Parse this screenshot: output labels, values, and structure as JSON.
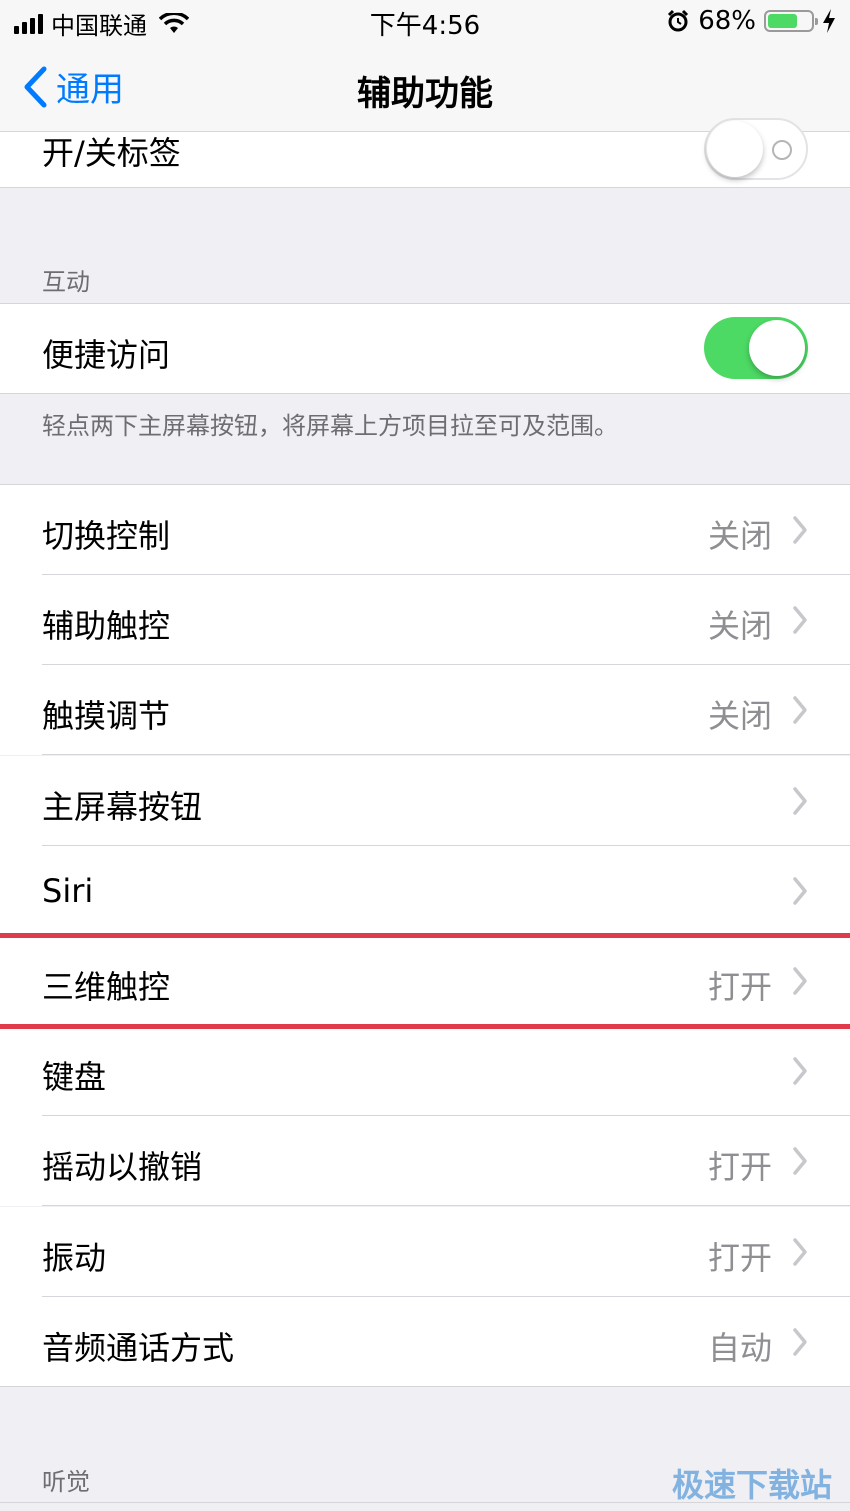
{
  "status_bar": {
    "carrier": "中国联通",
    "time": "下午4:56",
    "battery_percent": "68%",
    "battery_level": 0.68
  },
  "nav": {
    "back_label": "通用",
    "title": "辅助功能"
  },
  "top_cell": {
    "label": "开/关标签",
    "toggle": false
  },
  "section_interaction": {
    "header": "互动"
  },
  "reachability": {
    "label": "便捷访问",
    "toggle": true,
    "footer": "轻点两下主屏幕按钮，将屏幕上方项目拉至可及范围。"
  },
  "rows": [
    {
      "label": "切换控制",
      "value": "关闭"
    },
    {
      "label": "辅助触控",
      "value": "关闭"
    },
    {
      "label": "触摸调节",
      "value": "关闭"
    },
    {
      "label": "主屏幕按钮",
      "value": ""
    },
    {
      "label": "Siri",
      "value": ""
    },
    {
      "label": "三维触控",
      "value": "打开"
    },
    {
      "label": "键盘",
      "value": ""
    },
    {
      "label": "摇动以撤销",
      "value": "打开"
    },
    {
      "label": "振动",
      "value": "打开"
    },
    {
      "label": "音频通话方式",
      "value": "自动"
    }
  ],
  "section_hearing": {
    "header": "听觉"
  },
  "watermark": "极速下载站",
  "colors": {
    "accent": "#007aff",
    "toggle_on": "#4cd964",
    "highlight": "#e03b4a"
  }
}
